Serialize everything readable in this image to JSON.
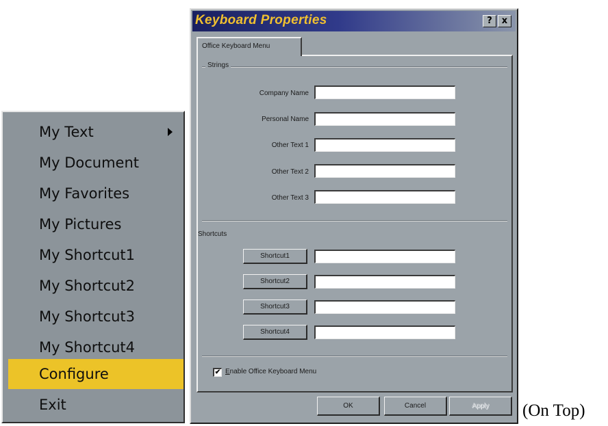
{
  "menu": {
    "items": [
      {
        "label": "My Text",
        "submenu": true
      },
      {
        "label": "My Document"
      },
      {
        "label": "My Favorites"
      },
      {
        "label": "My Pictures"
      },
      {
        "label": "My Shortcut1"
      },
      {
        "label": "My Shortcut2"
      },
      {
        "label": "My Shortcut3"
      },
      {
        "label": "My Shortcut4"
      },
      {
        "label": "Configure",
        "highlighted": true
      },
      {
        "label": "Exit"
      }
    ],
    "icons": {
      "submenu_arrow": "chevron-right-icon"
    },
    "colors": {
      "background": "#8c949a",
      "highlight": "#ecc328"
    }
  },
  "dialog": {
    "title": "Keyboard Properties",
    "help_button": "?",
    "close_button": "x",
    "tab_label": "Office Keyboard Menu",
    "strings_group": {
      "label": "Strings",
      "fields": [
        {
          "label": "Company Name",
          "value": ""
        },
        {
          "label": "Personal Name",
          "value": ""
        },
        {
          "label": "Other Text 1",
          "value": ""
        },
        {
          "label": "Other Text 2",
          "value": ""
        },
        {
          "label": "Other Text 3",
          "value": ""
        }
      ]
    },
    "shortcuts_group": {
      "label": "Shortcuts",
      "buttons": [
        {
          "label": "Shortcut1",
          "value": ""
        },
        {
          "label": "Shortcut2",
          "value": ""
        },
        {
          "label": "Shortcut3",
          "value": ""
        },
        {
          "label": "Shortcut4",
          "value": ""
        }
      ]
    },
    "enable_checkbox": {
      "checked": true,
      "mark": "✔",
      "label_mnemonic": "E",
      "label_rest": "nable Office Keyboard Menu"
    },
    "buttons": {
      "ok": "OK",
      "cancel": "Cancel",
      "apply": "Apply"
    },
    "colors": {
      "face": "#9ba3a9",
      "title_text": "#f0c030",
      "title_bar": "#1a2060"
    }
  },
  "caption": "(On Top)"
}
